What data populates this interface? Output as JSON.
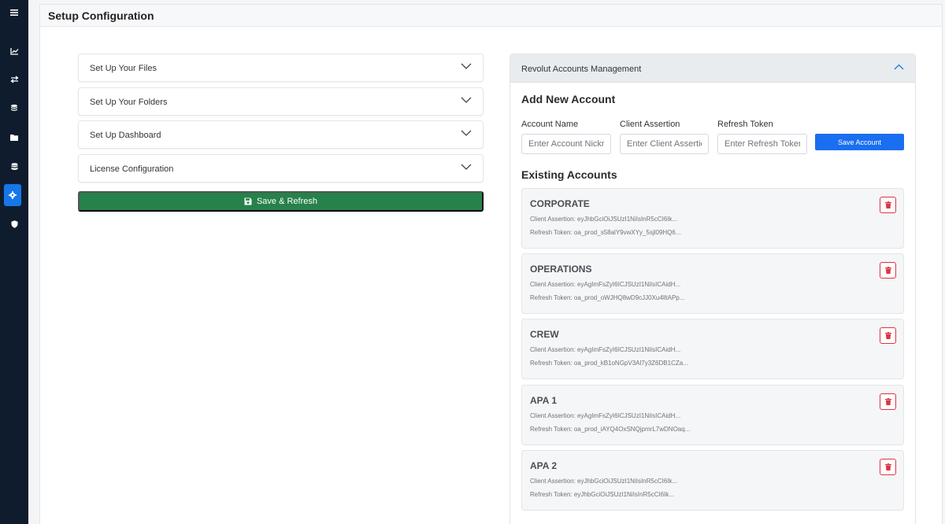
{
  "sidebar": {
    "items": [
      {
        "icon": "menu-icon"
      },
      {
        "icon": "chart-line-icon"
      },
      {
        "icon": "exchange-icon"
      },
      {
        "icon": "coins-icon"
      },
      {
        "icon": "folder-icon"
      },
      {
        "icon": "database-icon"
      },
      {
        "icon": "gear-icon",
        "active": true
      },
      {
        "icon": "shield-icon"
      }
    ]
  },
  "header": {
    "title": "Setup Configuration"
  },
  "accordion": {
    "items": [
      {
        "label": "Set Up Your Files"
      },
      {
        "label": "Set Up Your Folders"
      },
      {
        "label": "Set Up Dashboard"
      },
      {
        "label": "License Configuration"
      }
    ],
    "save_label": "Save & Refresh"
  },
  "revolut": {
    "title": "Revolut Accounts Management",
    "add_title": "Add New Account",
    "fields": {
      "account_name": {
        "label": "Account Name",
        "placeholder": "Enter Account Nickname"
      },
      "client_assertion": {
        "label": "Client Assertion",
        "placeholder": "Enter Client Assertion"
      },
      "refresh_token": {
        "label": "Refresh Token",
        "placeholder": "Enter Refresh Token"
      }
    },
    "save_label": "Save Account",
    "existing_title": "Existing Accounts",
    "accounts": [
      {
        "name": "CORPORATE",
        "client_assertion": "Client Assertion: eyJhbGciOiJSUzI1NiIsInR5cCI6Ik...",
        "refresh_token": "Refresh Token: oa_prod_s58alY9vwXYy_5sjl09HQ6..."
      },
      {
        "name": "OPERATIONS",
        "client_assertion": "Client Assertion: eyAgImFsZyI6ICJSUzI1NiIsICAidH...",
        "refresh_token": "Refresh Token: oa_prod_oWJHQ8wD9cJJ0Xu4lltAPp..."
      },
      {
        "name": "CREW",
        "client_assertion": "Client Assertion: eyAgImFsZyI6ICJSUzI1NiIsICAidH...",
        "refresh_token": "Refresh Token: oa_prod_kB1oNGpV3Al7y3Z6DB1CZa..."
      },
      {
        "name": "APA 1",
        "client_assertion": "Client Assertion: eyAgImFsZyI6ICJSUzI1NiIsICAidH...",
        "refresh_token": "Refresh Token: oa_prod_iAYQ4OxSNQjpmrL7wDNOaq..."
      },
      {
        "name": "APA 2",
        "client_assertion": "Client Assertion: eyJhbGciOiJSUzI1NiIsInR5cCI6Ik...",
        "refresh_token": "Refresh Token: eyJhbGciOiJSUzI1NiIsInR5cCI6Ik..."
      }
    ]
  },
  "colors": {
    "sidebar_bg": "#0f1c2e",
    "sidebar_active": "#1677e8",
    "save_refresh": "#26814a",
    "save_account": "#1a6ef0",
    "delete": "#dc3545"
  }
}
